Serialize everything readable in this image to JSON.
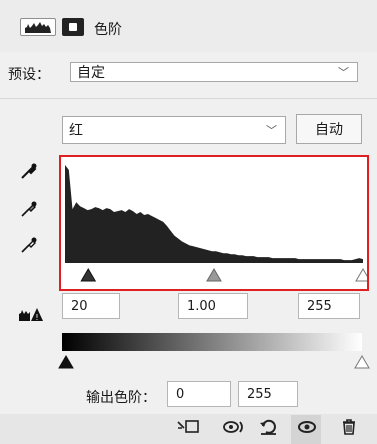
{
  "header": {
    "title": "色阶",
    "levels_icon": "levels-icon",
    "mask_icon": "mask-icon"
  },
  "preset": {
    "label": "预设：",
    "value": "自定"
  },
  "channel": {
    "value": "红",
    "auto_label": "自动"
  },
  "eyedroppers": [
    "black-point-eyedropper-icon",
    "gray-point-eyedropper-icon",
    "white-point-eyedropper-icon"
  ],
  "histogram": {
    "channel_color": "#222222",
    "highlight_color": "#e02020",
    "profile": [
      1.0,
      0.95,
      0.55,
      0.62,
      0.58,
      0.56,
      0.54,
      0.55,
      0.57,
      0.56,
      0.54,
      0.56,
      0.55,
      0.52,
      0.53,
      0.54,
      0.52,
      0.55,
      0.53,
      0.5,
      0.52,
      0.49,
      0.5,
      0.48,
      0.46,
      0.44,
      0.42,
      0.38,
      0.33,
      0.28,
      0.25,
      0.22,
      0.2,
      0.18,
      0.17,
      0.16,
      0.15,
      0.14,
      0.13,
      0.12,
      0.12,
      0.11,
      0.1,
      0.1,
      0.09,
      0.09,
      0.08,
      0.08,
      0.07,
      0.07,
      0.07,
      0.06,
      0.06,
      0.06,
      0.06,
      0.05,
      0.05,
      0.05,
      0.05,
      0.05,
      0.05,
      0.05,
      0.04,
      0.04,
      0.04,
      0.04,
      0.04,
      0.04,
      0.04,
      0.04,
      0.04,
      0.04,
      0.04,
      0.04,
      0.03,
      0.03,
      0.03,
      0.04,
      0.05,
      0.04
    ]
  },
  "input_levels": {
    "icon": "auto-clip-warning-icon",
    "black": "20",
    "gamma": "1.00",
    "white": "255",
    "black_fraction": 0.078,
    "gamma_fraction": 0.5,
    "white_fraction": 1.0
  },
  "output_levels": {
    "label": "输出色阶：",
    "black": "0",
    "white": "255"
  },
  "footer_icons": [
    "clip-to-layer-icon",
    "view-previous-state-icon",
    "reset-icon",
    "visibility-icon",
    "delete-icon"
  ]
}
